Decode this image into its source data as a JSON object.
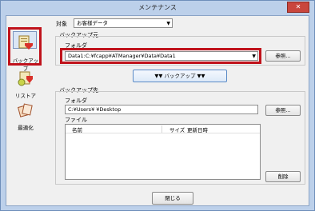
{
  "window": {
    "title": "メンテナンス",
    "close_label": "✕"
  },
  "sidebar": {
    "items": [
      {
        "label": "バックアップ",
        "icon": "backup-icon"
      },
      {
        "label": "リストア",
        "icon": "restore-icon"
      },
      {
        "label": "最適化",
        "icon": "optimize-icon"
      }
    ]
  },
  "target": {
    "label": "対象",
    "value": "お客様データ"
  },
  "backup_source": {
    "group_label": "バックアップ元",
    "folder_label": "フォルダ",
    "folder_value": "Data1:C:¥fcapp¥ATManager¥Data¥Data1",
    "browse_label": "参照..."
  },
  "backup_button": {
    "label": "▼▼  バックアップ  ▼▼"
  },
  "backup_dest": {
    "group_label": "バックアップ先",
    "folder_label": "フォルダ",
    "folder_value": "C:¥Users¥            ¥Desktop",
    "browse_label": "参照...",
    "files_label": "ファイル",
    "columns": [
      "名前",
      "サイズ",
      "更新日時"
    ],
    "delete_label": "削除"
  },
  "close_button": {
    "label": "閉じる"
  }
}
